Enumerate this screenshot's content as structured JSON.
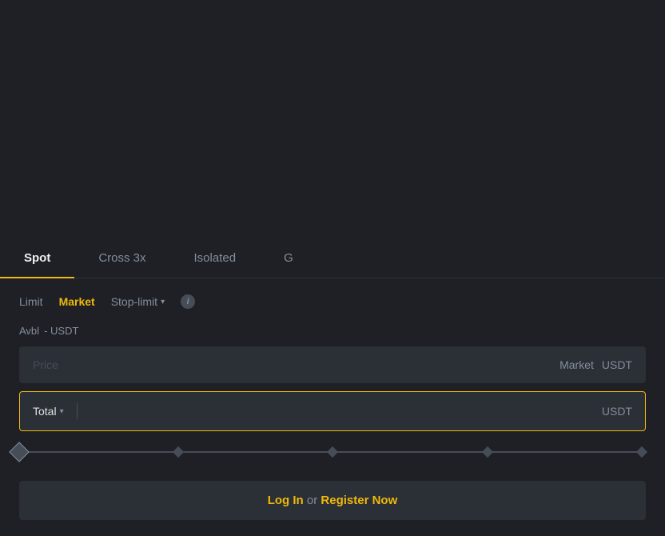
{
  "tabs": [
    {
      "id": "spot",
      "label": "Spot",
      "active": true
    },
    {
      "id": "cross3x",
      "label": "Cross 3x",
      "active": false
    },
    {
      "id": "isolated",
      "label": "Isolated",
      "active": false
    },
    {
      "id": "g",
      "label": "G",
      "active": false
    }
  ],
  "order_types": [
    {
      "id": "limit",
      "label": "Limit",
      "active": false
    },
    {
      "id": "market",
      "label": "Market",
      "active": true
    },
    {
      "id": "stop_limit",
      "label": "Stop-limit",
      "active": false
    }
  ],
  "info_icon_label": "i",
  "avbl": {
    "label": "Avbl",
    "value": "- USDT"
  },
  "price_input": {
    "placeholder": "Price",
    "label": "Market",
    "currency": "USDT"
  },
  "total_input": {
    "label": "Total",
    "currency": "USDT",
    "value": ""
  },
  "slider": {
    "value": 0,
    "steps": [
      "0%",
      "25%",
      "50%",
      "75%",
      "100%"
    ]
  },
  "login_button": {
    "login_label": "Log In",
    "separator": " or ",
    "register_label": "Register Now"
  },
  "colors": {
    "active_tab_underline": "#f0b90b",
    "active_order_type": "#f0b90b",
    "background": "#1e2026",
    "input_bg": "#2b2f36"
  }
}
